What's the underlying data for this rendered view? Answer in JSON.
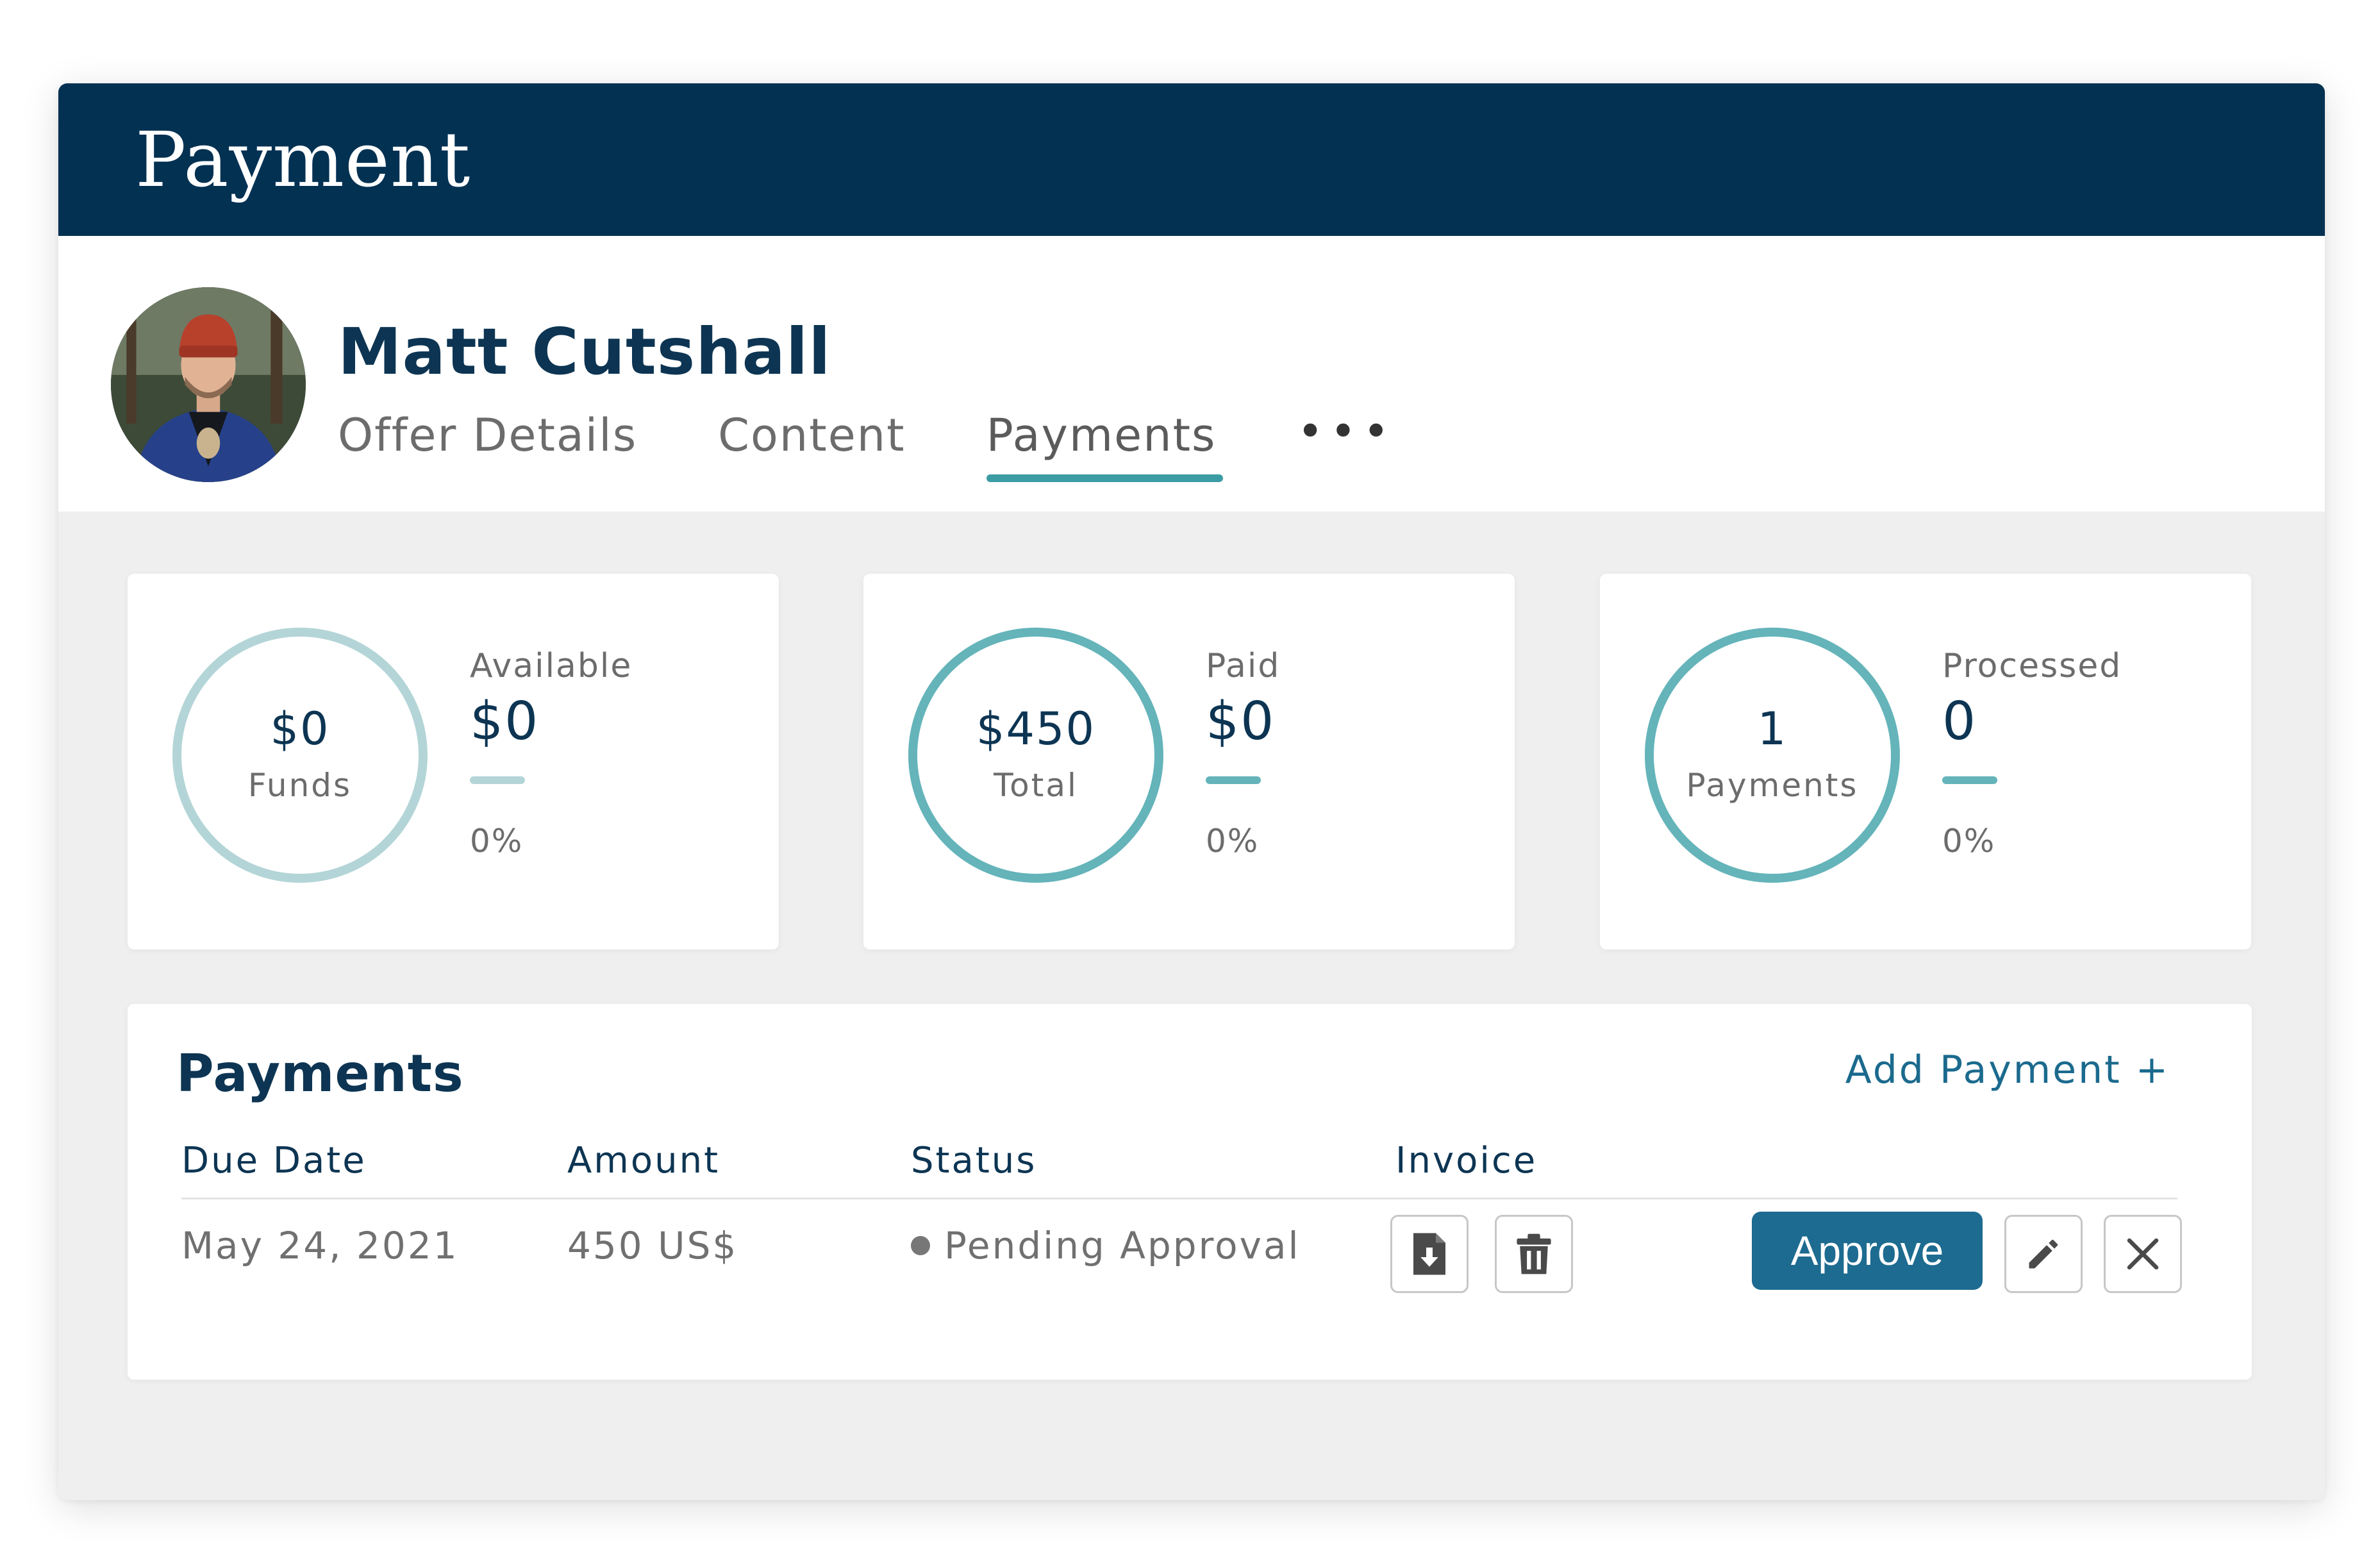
{
  "window": {
    "title": "Payment"
  },
  "profile": {
    "name": "Matt Cutshall"
  },
  "tabs": [
    {
      "label": "Offer Details",
      "active": false
    },
    {
      "label": "Content",
      "active": false
    },
    {
      "label": "Payments",
      "active": true
    }
  ],
  "tabs_more": "•••",
  "stats": [
    {
      "ring_value": "$0",
      "ring_label": "Funds",
      "label": "Available",
      "value": "$0",
      "percent": "0%"
    },
    {
      "ring_value": "$450",
      "ring_label": "Total",
      "label": "Paid",
      "value": "$0",
      "percent": "0%"
    },
    {
      "ring_value": "1",
      "ring_label": "Payments",
      "label": "Processed",
      "value": "0",
      "percent": "0%"
    }
  ],
  "payments": {
    "title": "Payments",
    "add_label": "Add Payment +",
    "columns": [
      "Due Date",
      "Amount",
      "Status",
      "Invoice"
    ],
    "rows": [
      {
        "due_date": "May 24, 2021",
        "amount": "450 US$",
        "status": "Pending Approval"
      }
    ],
    "approve_label": "Approve"
  },
  "icons": {
    "more": "more-horizontal-icon",
    "download": "download-file-icon",
    "delete": "trash-icon",
    "edit": "pencil-icon",
    "close": "close-icon"
  },
  "colors": {
    "header": "#033152",
    "heading_text": "#0d3553",
    "accent": "#3c9ca4",
    "ring_strong": "#64b4ba",
    "ring_light": "#b4d5d7",
    "approve": "#1d6b90",
    "link": "#1b6a8e"
  }
}
